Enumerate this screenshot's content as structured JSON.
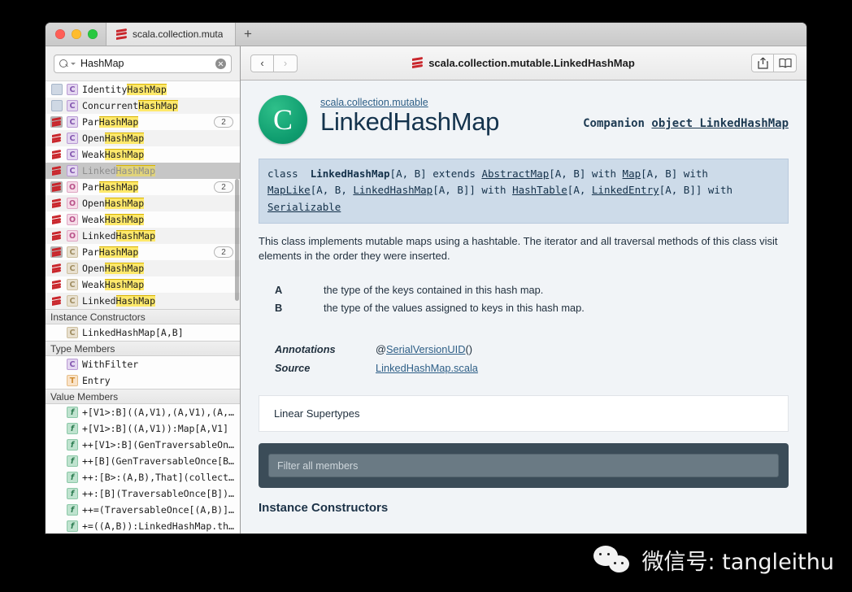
{
  "window": {
    "tab_title": "scala.collection.muta",
    "new_tab_label": "+"
  },
  "search": {
    "value": "HashMap",
    "placeholder": "Search"
  },
  "sidebar": {
    "rows": [
      {
        "label_pre": "Identity",
        "label_hl": "HashMap",
        "label_post": "",
        "kind": "C",
        "kindclass": "c-purple",
        "flag": "misc",
        "badge": "",
        "state": "clipped"
      },
      {
        "label_pre": "Concurrent",
        "label_hl": "HashMap",
        "label_post": "",
        "kind": "C",
        "kindclass": "c-purple",
        "flag": "misc",
        "badge": "",
        "state": ""
      },
      {
        "label_pre": "Par",
        "label_hl": "HashMap",
        "label_post": "",
        "kind": "C",
        "kindclass": "c-purple",
        "flag": "boxed",
        "badge": "2",
        "state": ""
      },
      {
        "label_pre": "Open",
        "label_hl": "HashMap",
        "label_post": "",
        "kind": "C",
        "kindclass": "c-purple",
        "flag": "plain",
        "badge": "",
        "state": ""
      },
      {
        "label_pre": "Weak",
        "label_hl": "HashMap",
        "label_post": "",
        "kind": "C",
        "kindclass": "c-purple",
        "flag": "plain",
        "badge": "",
        "state": ""
      },
      {
        "label_pre": "Linked",
        "label_hl": "HashMap",
        "label_post": "",
        "kind": "C",
        "kindclass": "c-purple",
        "flag": "plain",
        "badge": "",
        "state": "selected"
      },
      {
        "label_pre": "Par",
        "label_hl": "HashMap",
        "label_post": "",
        "kind": "O",
        "kindclass": "o-pink",
        "flag": "boxed",
        "badge": "2",
        "state": ""
      },
      {
        "label_pre": "Open",
        "label_hl": "HashMap",
        "label_post": "",
        "kind": "O",
        "kindclass": "o-pink",
        "flag": "plain",
        "badge": "",
        "state": ""
      },
      {
        "label_pre": "Weak",
        "label_hl": "HashMap",
        "label_post": "",
        "kind": "O",
        "kindclass": "o-pink",
        "flag": "plain",
        "badge": "",
        "state": ""
      },
      {
        "label_pre": "Linked",
        "label_hl": "HashMap",
        "label_post": "",
        "kind": "O",
        "kindclass": "o-pink",
        "flag": "plain",
        "badge": "",
        "state": ""
      },
      {
        "label_pre": "Par",
        "label_hl": "HashMap",
        "label_post": "",
        "kind": "C",
        "kindclass": "c-tan",
        "flag": "boxed",
        "badge": "2",
        "state": ""
      },
      {
        "label_pre": "Open",
        "label_hl": "HashMap",
        "label_post": "",
        "kind": "C",
        "kindclass": "c-tan",
        "flag": "plain",
        "badge": "",
        "state": ""
      },
      {
        "label_pre": "Weak",
        "label_hl": "HashMap",
        "label_post": "",
        "kind": "C",
        "kindclass": "c-tan",
        "flag": "plain",
        "badge": "",
        "state": ""
      },
      {
        "label_pre": "Linked",
        "label_hl": "HashMap",
        "label_post": "",
        "kind": "C",
        "kindclass": "c-tan",
        "flag": "plain",
        "badge": "",
        "state": ""
      }
    ],
    "groups": [
      {
        "header": "Instance Constructors",
        "items": [
          {
            "label": "LinkedHashMap[A,B]",
            "kind": "C",
            "kindclass": "c-tan"
          }
        ]
      },
      {
        "header": "Type Members",
        "items": [
          {
            "label": "WithFilter",
            "kind": "C",
            "kindclass": "c-purple"
          },
          {
            "label": "Entry",
            "kind": "T",
            "kindclass": "t-orange"
          }
        ]
      },
      {
        "header": "Value Members",
        "items": [
          {
            "label": "+[V1>:B]((A,V1),(A,V1),(A,V…",
            "kind": "f",
            "kindclass": "f-green"
          },
          {
            "label": "+[V1>:B]((A,V1)):Map[A,V1]",
            "kind": "f",
            "kindclass": "f-green"
          },
          {
            "label": "++[V1>:B](GenTraversableOnc…",
            "kind": "f",
            "kindclass": "f-green"
          },
          {
            "label": "++[B](GenTraversableOnce[B]…",
            "kind": "f",
            "kindclass": "f-green"
          },
          {
            "label": "++:[B>:(A,B),That](collecti…",
            "kind": "f",
            "kindclass": "f-green"
          },
          {
            "label": "++:[B](TraversableOnce[B]):…",
            "kind": "f",
            "kindclass": "f-green"
          },
          {
            "label": "++=(TraversableOnce[(A,B)])…",
            "kind": "f",
            "kindclass": "f-green"
          },
          {
            "label": "+=((A,B)):LinkedHashMap.thi…",
            "kind": "f",
            "kindclass": "f-green"
          }
        ]
      }
    ]
  },
  "toolbar": {
    "back_label": "‹",
    "forward_label": "›",
    "doc_title": "scala.collection.mutable.LinkedHashMap",
    "share_icon": "share-icon",
    "bookmarks_icon": "bookmarks-icon"
  },
  "doc": {
    "badge_letter": "C",
    "package": "scala.collection.mutable",
    "class_name": "LinkedHashMap",
    "companion_label": "Companion",
    "companion_link": "object LinkedHashMap",
    "signature": {
      "line1_kw": "class",
      "line1_name": "LinkedHashMap",
      "line1_params": "[A, B] extends ",
      "line1_link1": "AbstractMap",
      "line1_mid": "[A, B] with ",
      "line1_link2": "Map",
      "line1_end": "[A, B] with",
      "line2_link1": "MapLike",
      "line2_a": "[A, B, ",
      "line2_link2": "LinkedHashMap",
      "line2_b": "[A, B]] with ",
      "line2_link3": "HashTable",
      "line2_c": "[A, ",
      "line2_link4": "LinkedEntry",
      "line2_d": "[A, B]] with",
      "line3_link": "Serializable"
    },
    "description": "This class implements mutable maps using a hashtable. The iterator and all traversal methods of this class visit elements in the order they were inserted.",
    "type_params": [
      {
        "name": "A",
        "desc": "the type of the keys contained in this hash map."
      },
      {
        "name": "B",
        "desc": "the type of the values assigned to keys in this hash map."
      }
    ],
    "meta": [
      {
        "key": "Annotations",
        "prefix": "@",
        "link": "SerialVersionUID",
        "suffix": "()"
      },
      {
        "key": "Source",
        "prefix": "",
        "link": "LinkedHashMap.scala",
        "suffix": ""
      }
    ],
    "linear_supertypes_label": "Linear Supertypes",
    "filter_placeholder": "Filter all members",
    "next_section": "Instance Constructors"
  },
  "watermark": {
    "text": "微信号: tangleithu"
  },
  "colors": {
    "accent_green": "#0f9d6f",
    "scala_red": "#c9262c",
    "signature_bg": "#cddbe9",
    "filter_bg": "#3b4c58",
    "highlight": "#ffe96b"
  }
}
